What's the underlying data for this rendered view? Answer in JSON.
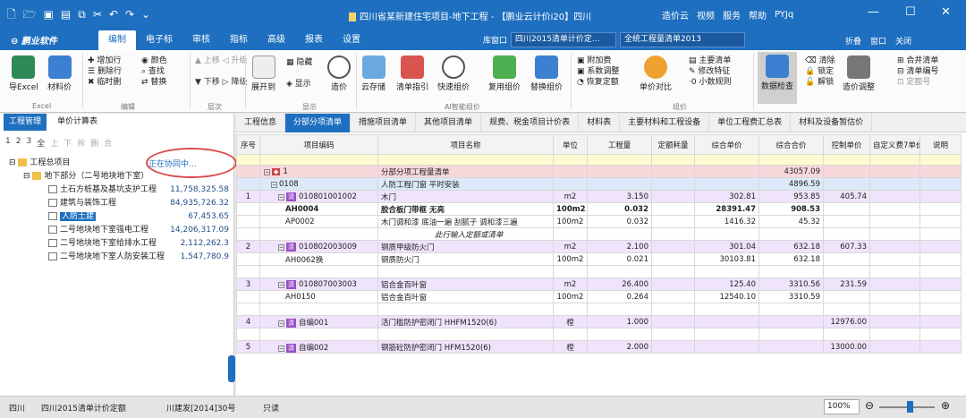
{
  "window": {
    "title": "四川省某新建住宅项目-地下工程 - 【鹏业云计价i20】四川",
    "right": [
      "造价云",
      "视频",
      "服务",
      "帮助",
      "PYJq"
    ]
  },
  "menubar": {
    "logo": "鹏业软件",
    "tabs": [
      "编制",
      "电子标",
      "审核",
      "指标",
      "高级",
      "报表",
      "设置"
    ],
    "active": 0,
    "dock": "库窗口",
    "standard": "四川2015清单计价定...",
    "scheme": "全统工程量清单2013",
    "right": [
      "折叠",
      "窗口",
      "关闭"
    ]
  },
  "ribbon": {
    "excel": [
      "导Excel",
      "材料价"
    ],
    "edit": [
      "增加行",
      "删除行",
      "临时删",
      "颜色",
      "查找",
      "替换"
    ],
    "edit_group": "编辑",
    "excel_group": "Excel",
    "level": [
      "上移",
      "下移",
      "升级",
      "降级"
    ],
    "level_group": "层次",
    "show": [
      "展开到",
      "隐藏",
      "显示",
      "造价"
    ],
    "show_group": "显示",
    "ai": [
      "云存储",
      "清单指引",
      "快速组价",
      "复用组价",
      "替换组价"
    ],
    "ai_group": "AI智能组价",
    "price": [
      "附加费",
      "系数调整",
      "恢复定额",
      "单价对比"
    ],
    "price2": [
      "主要清单",
      "修改特征",
      "小数规则"
    ],
    "price_group": "组价",
    "check": [
      "数据检查",
      "清除",
      "锁定",
      "解锁",
      "造价调整",
      "合并清单",
      "清单编号",
      "定额号"
    ]
  },
  "left": {
    "tabs": [
      "工程管理",
      "单价计算表"
    ],
    "toolbar": [
      "1",
      "2",
      "3",
      "全",
      "上",
      "下",
      "拆",
      "删",
      "合"
    ],
    "collab": "正在协同中...",
    "tree": [
      {
        "name": "工程总项目",
        "amount": ""
      },
      {
        "name": "地下部分（二号地块地下室）",
        "amount": ""
      },
      {
        "name": "土石方桩基及基坑支护工程",
        "amount": "11,758,325.58"
      },
      {
        "name": "建筑与装饰工程",
        "amount": "84,935,726.32"
      },
      {
        "name": "人防土建",
        "amount": "67,453.65"
      },
      {
        "name": "二号地块地下室强电工程",
        "amount": "14,206,317.09"
      },
      {
        "name": "二号地块地下室给排水工程",
        "amount": "2,112,262.3"
      },
      {
        "name": "二号地块地下室人防安装工程",
        "amount": "1,547,780.9"
      }
    ]
  },
  "right": {
    "tabs": [
      "工程信息",
      "分部分项清单",
      "措施项目清单",
      "其他项目清单",
      "规费、税金项目计价表",
      "材料表",
      "主要材料和工程设备",
      "单位工程费汇总表",
      "材料及设备暂估价"
    ],
    "active": 1,
    "headers": [
      "序号",
      "项目编码",
      "项目名称",
      "单位",
      "工程量",
      "定额耗量",
      "综合单价",
      "综合合价",
      "控制单价",
      "自定义费7单价",
      "说明"
    ],
    "rows": [
      {
        "cls": "pink",
        "seq": "",
        "code": "1",
        "name": "分部分项工程量清单",
        "unit": "",
        "qty": "",
        "con": "",
        "price": "",
        "total": "43057.09",
        "ctrl": "",
        "badge": "r"
      },
      {
        "cls": "blue",
        "seq": "",
        "code": "0108",
        "name": "人防工程门窗 平时安装",
        "unit": "",
        "qty": "",
        "con": "",
        "price": "",
        "total": "4896.59",
        "ctrl": ""
      },
      {
        "cls": "pur",
        "seq": "1",
        "code": "010801001002",
        "name": "木门",
        "unit": "m2",
        "qty": "3.150",
        "con": "",
        "price": "302.81",
        "total": "953.85",
        "ctrl": "405.74",
        "badge": "清"
      },
      {
        "cls": "b",
        "seq": "",
        "code": "AH0004",
        "name": "胶合板门带框 无亮",
        "unit": "100m2",
        "qty": "0.032",
        "con": "",
        "price": "28391.47",
        "total": "908.53",
        "ctrl": ""
      },
      {
        "cls": "",
        "seq": "",
        "code": "AP0002",
        "name": "木门调和漆 底油一遍 刮腻子 调和漆三遍",
        "unit": "100m2",
        "qty": "0.032",
        "con": "",
        "price": "1416.32",
        "total": "45.32",
        "ctrl": ""
      },
      {
        "cls": "",
        "seq": "",
        "code": "",
        "name": "此行输入定额或清单",
        "unit": "",
        "qty": "",
        "con": "",
        "price": "",
        "total": "",
        "ctrl": ""
      },
      {
        "cls": "pur",
        "seq": "2",
        "code": "010802003009",
        "name": "钢质甲级防火门",
        "unit": "m2",
        "qty": "2.100",
        "con": "",
        "price": "301.04",
        "total": "632.18",
        "ctrl": "607.33",
        "badge": "清"
      },
      {
        "cls": "",
        "seq": "",
        "code": "AH0062换",
        "name": "钢质防火门",
        "unit": "100m2",
        "qty": "0.021",
        "con": "",
        "price": "30103.81",
        "total": "632.18",
        "ctrl": ""
      },
      {
        "cls": "",
        "seq": "",
        "code": "",
        "name": "",
        "unit": "",
        "qty": "",
        "con": "",
        "price": "",
        "total": "",
        "ctrl": ""
      },
      {
        "cls": "pur",
        "seq": "3",
        "code": "010807003003",
        "name": "铝合金百叶窗",
        "unit": "m2",
        "qty": "26.400",
        "con": "",
        "price": "125.40",
        "total": "3310.56",
        "ctrl": "231.59",
        "badge": "清"
      },
      {
        "cls": "",
        "seq": "",
        "code": "AH0150",
        "name": "铝合金百叶窗",
        "unit": "100m2",
        "qty": "0.264",
        "con": "",
        "price": "12540.10",
        "total": "3310.59",
        "ctrl": ""
      },
      {
        "cls": "",
        "seq": "",
        "code": "",
        "name": "",
        "unit": "",
        "qty": "",
        "con": "",
        "price": "",
        "total": "",
        "ctrl": ""
      },
      {
        "cls": "pur",
        "seq": "4",
        "code": "自编001",
        "name": "活门槛防护密闭门 HHFM1520(6)",
        "unit": "樘",
        "qty": "1.000",
        "con": "",
        "price": "",
        "total": "",
        "ctrl": "12976.00",
        "badge": "清"
      },
      {
        "cls": "",
        "seq": "",
        "code": "",
        "name": "",
        "unit": "",
        "qty": "",
        "con": "",
        "price": "",
        "total": "",
        "ctrl": ""
      },
      {
        "cls": "pur",
        "seq": "5",
        "code": "自编002",
        "name": "钢筋砼防护密闭门 HFM1520(6)",
        "unit": "樘",
        "qty": "2.000",
        "con": "",
        "price": "",
        "total": "",
        "ctrl": "13000.00",
        "badge": "清"
      }
    ]
  },
  "status": {
    "region": "四川",
    "std": "四川2015清单计价定额",
    "doc": "川建发[2014]30号",
    "mode": "只读",
    "zoom": "100%"
  }
}
